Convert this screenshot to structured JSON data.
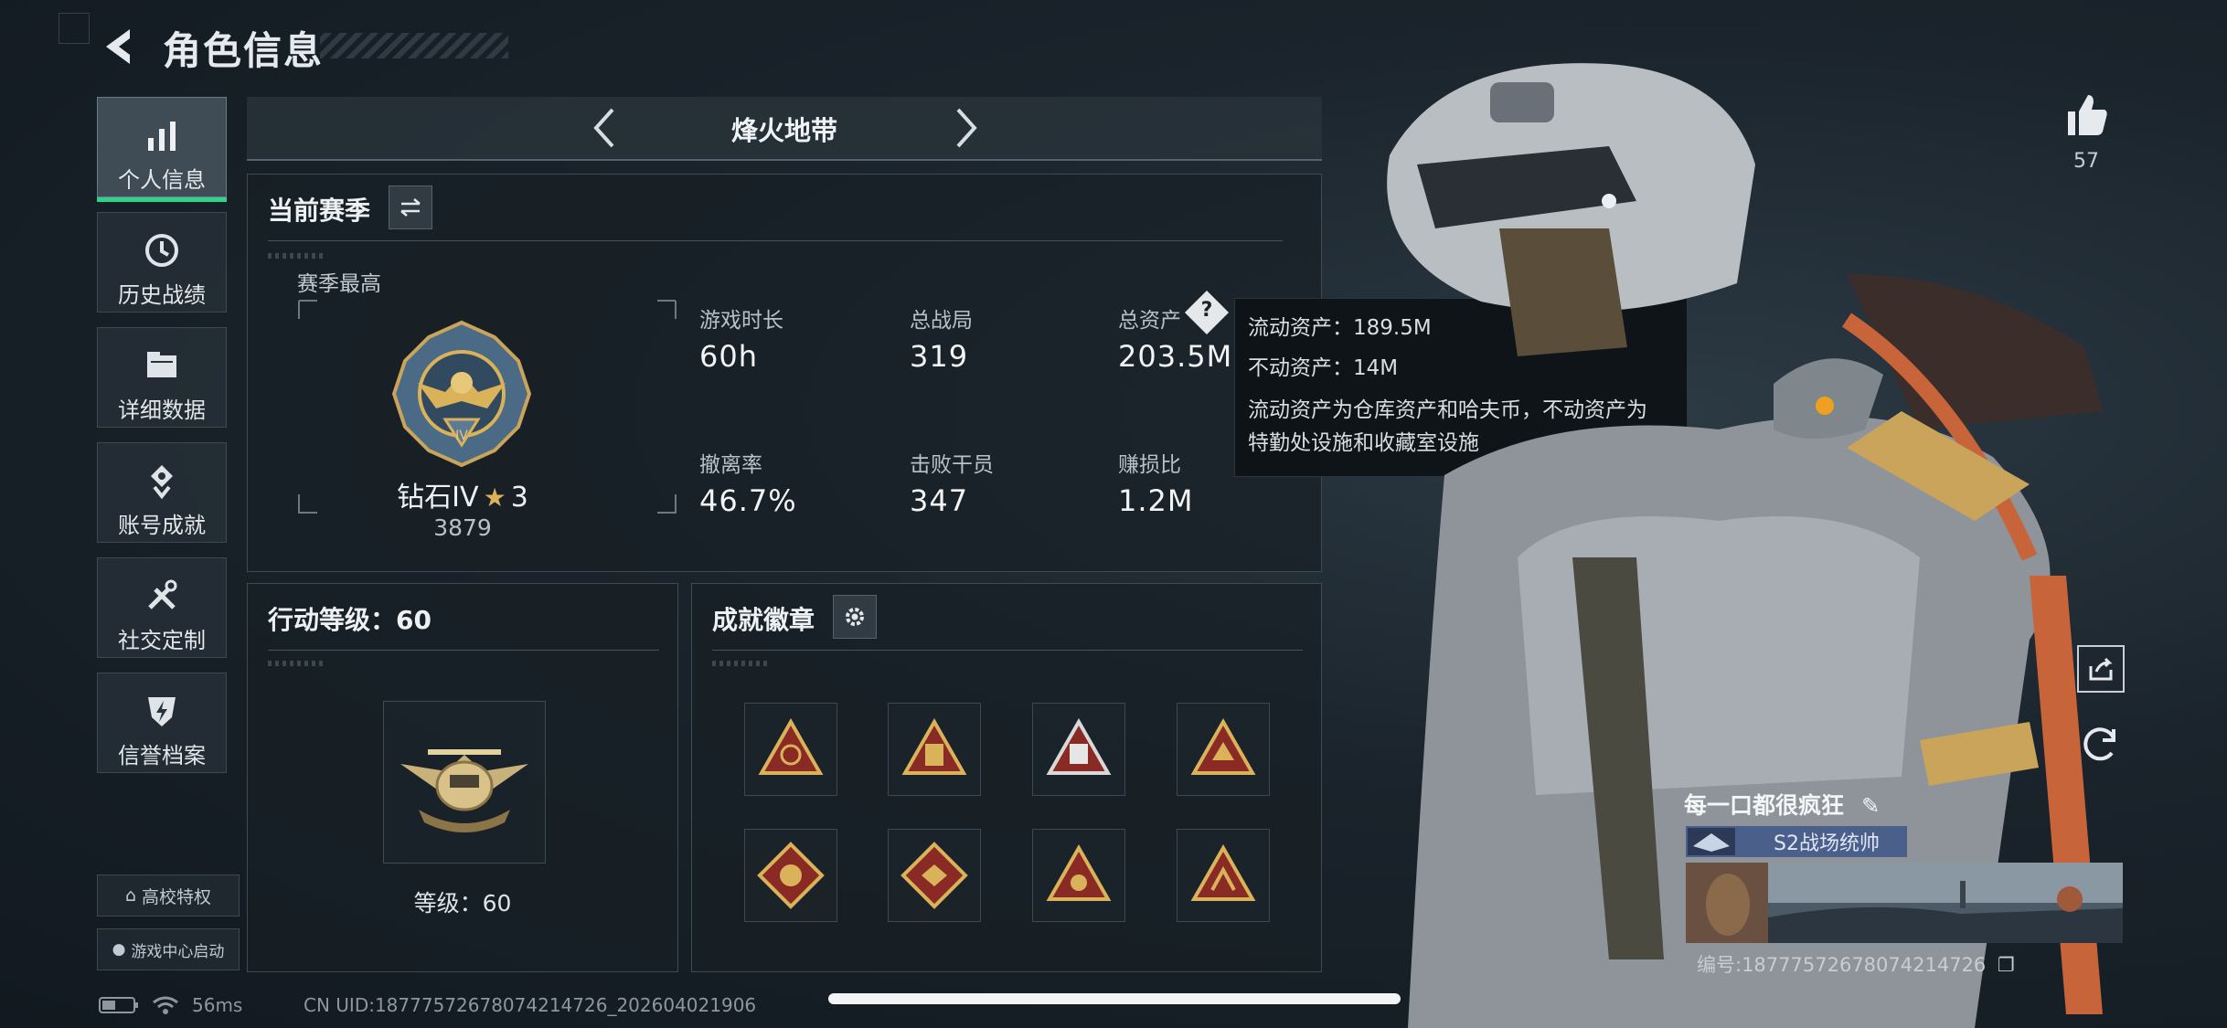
{
  "header": {
    "title": "角色信息"
  },
  "nav": {
    "items": [
      {
        "label": "个人信息",
        "icon": "bar-chart-icon",
        "active": true
      },
      {
        "label": "历史战绩",
        "icon": "history-clock-icon",
        "active": false
      },
      {
        "label": "详细数据",
        "icon": "folder-icon",
        "active": false
      },
      {
        "label": "账号成就",
        "icon": "achievement-icon",
        "active": false
      },
      {
        "label": "社交定制",
        "icon": "tools-icon",
        "active": false
      },
      {
        "label": "信誉档案",
        "icon": "shield-bolt-icon",
        "active": false
      }
    ],
    "bottom_buttons": [
      {
        "label": "高校特权"
      },
      {
        "label": "游戏中心启动"
      }
    ]
  },
  "mode": {
    "label": "烽火地带"
  },
  "season": {
    "title": "当前赛季",
    "best_label": "赛季最高",
    "rank_name": "钻石IV",
    "rank_stars": "3",
    "rank_score": "3879",
    "stats": [
      {
        "label": "游戏时长",
        "value": "60h"
      },
      {
        "label": "总战局",
        "value": "319"
      },
      {
        "label": "总资产",
        "value": "203.5M"
      },
      {
        "label": "撤离率",
        "value": "46.7%"
      },
      {
        "label": "击败干员",
        "value": "347"
      },
      {
        "label": "赚损比",
        "value": "1.2M"
      }
    ]
  },
  "tooltip": {
    "liquid": "流动资产：189.5M",
    "fixed": "不动资产：14M",
    "desc_1": "流动资产为仓库资产和哈夫币，不动资产为",
    "desc_2": "特勤处设施和收藏室设施"
  },
  "action_level": {
    "title": "行动等级：60",
    "level_text": "等级：60"
  },
  "badges": {
    "title": "成就徽章",
    "items": [
      "badge-1",
      "badge-2",
      "badge-3",
      "badge-4",
      "badge-5",
      "badge-6",
      "badge-7",
      "badge-8"
    ]
  },
  "right": {
    "like_count": "57",
    "player_name": "每一口都很疯狂",
    "title_tag": "S2战场统帅",
    "uid": "编号:18777572678074214726"
  },
  "bottom": {
    "ping": "56ms",
    "cn_uid": "CN UID:18777572678074214726_202604021906"
  },
  "colors": {
    "accent": "#2fd38c",
    "gold": "#d9b25a",
    "panel": "#18202a"
  }
}
